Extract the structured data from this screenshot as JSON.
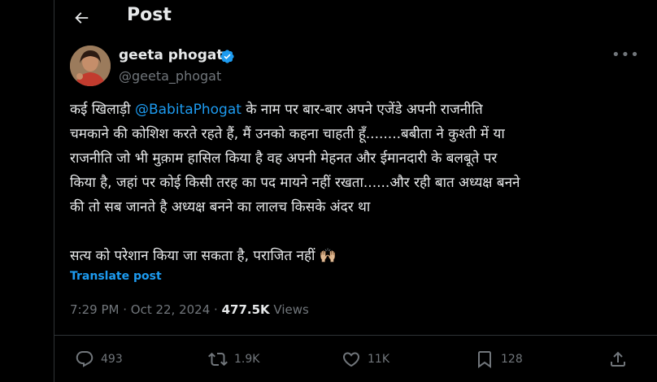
{
  "header": {
    "title": "Post"
  },
  "author": {
    "display_name": "geeta phogat",
    "handle": "@geeta_phogat"
  },
  "tweet": {
    "lines": [
      {
        "before": "कई खिलाड़ी ",
        "mention": "@BabitaPhogat",
        "after": " के नाम पर बार-बार अपने एजेंडे अपनी राजनीति"
      },
      {
        "text": "चमकाने की कोशिश करते रहते हैं, मैं उनको कहना चाहती हूँ........बबीता ने कुश्ती में या"
      },
      {
        "text": "राजनीति जो भी मुक़ाम हासिल किया है वह अपनी मेहनत और ईमानदारी के बलबूते पर"
      },
      {
        "text": "किया है, जहां पर कोई किसी तरह का पद मायने नहीं रखता......और रही बात अध्यक्ष बनने"
      },
      {
        "text": "की तो सब जानते है अध्यक्ष बनने का लालच किसके अंदर था"
      },
      {
        "text": "सत्य को परेशान किया जा सकता है, पराजित नहीं 🙌🏼"
      }
    ],
    "translate_label": "Translate post"
  },
  "meta": {
    "time": "7:29 PM",
    "separator": " · ",
    "date": "Oct 22, 2024",
    "views_count": "477.5K",
    "views_label": " Views"
  },
  "actions": {
    "replies": "493",
    "reposts": "1.9K",
    "likes": "11K",
    "bookmarks": "128"
  },
  "colors": {
    "accent": "#1d9bf0",
    "muted": "#71767b",
    "text": "#e7e9ea",
    "background": "#000000"
  },
  "icons": [
    "back-arrow-icon",
    "verified-badge-icon",
    "more-icon",
    "reply-icon",
    "repost-icon",
    "like-icon",
    "bookmark-icon",
    "share-icon"
  ]
}
